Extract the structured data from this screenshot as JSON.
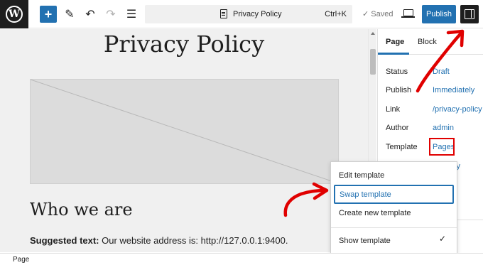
{
  "toolbar": {
    "wp_logo": "W",
    "add_icon": "+",
    "pen_icon": "✎",
    "undo_icon": "↶",
    "redo_icon": "↷",
    "list_icon": "☰",
    "document_title": "Privacy Policy",
    "shortcut": "Ctrl+K",
    "saved_label": "✓  Saved",
    "publish_label": "Publish"
  },
  "canvas": {
    "page_title": "Privacy Policy",
    "heading": "Who we are",
    "paragraph_bold": "Suggested text:",
    "paragraph_text": " Our website address is: http://127.0.0.1:9400."
  },
  "sidebar": {
    "tabs": [
      {
        "label": "Page"
      },
      {
        "label": "Block"
      }
    ],
    "rows": [
      {
        "label": "Status",
        "value": "Draft"
      },
      {
        "label": "Publish",
        "value": "Immediately"
      },
      {
        "label": "Link",
        "value": "/privacy-policy"
      },
      {
        "label": "Author",
        "value": "admin"
      },
      {
        "label": "Template",
        "value": "Pages"
      }
    ],
    "partial_text": "ly"
  },
  "dropdown": {
    "items": [
      {
        "label": "Edit template"
      },
      {
        "label": "Swap template"
      },
      {
        "label": "Create new template"
      },
      {
        "label": "Show template"
      }
    ],
    "check": "✓"
  },
  "statusbar": {
    "label": "Page"
  },
  "colors": {
    "accent": "#2271b1",
    "annotation_red": "#e00000",
    "dark": "#1e1e1e"
  }
}
